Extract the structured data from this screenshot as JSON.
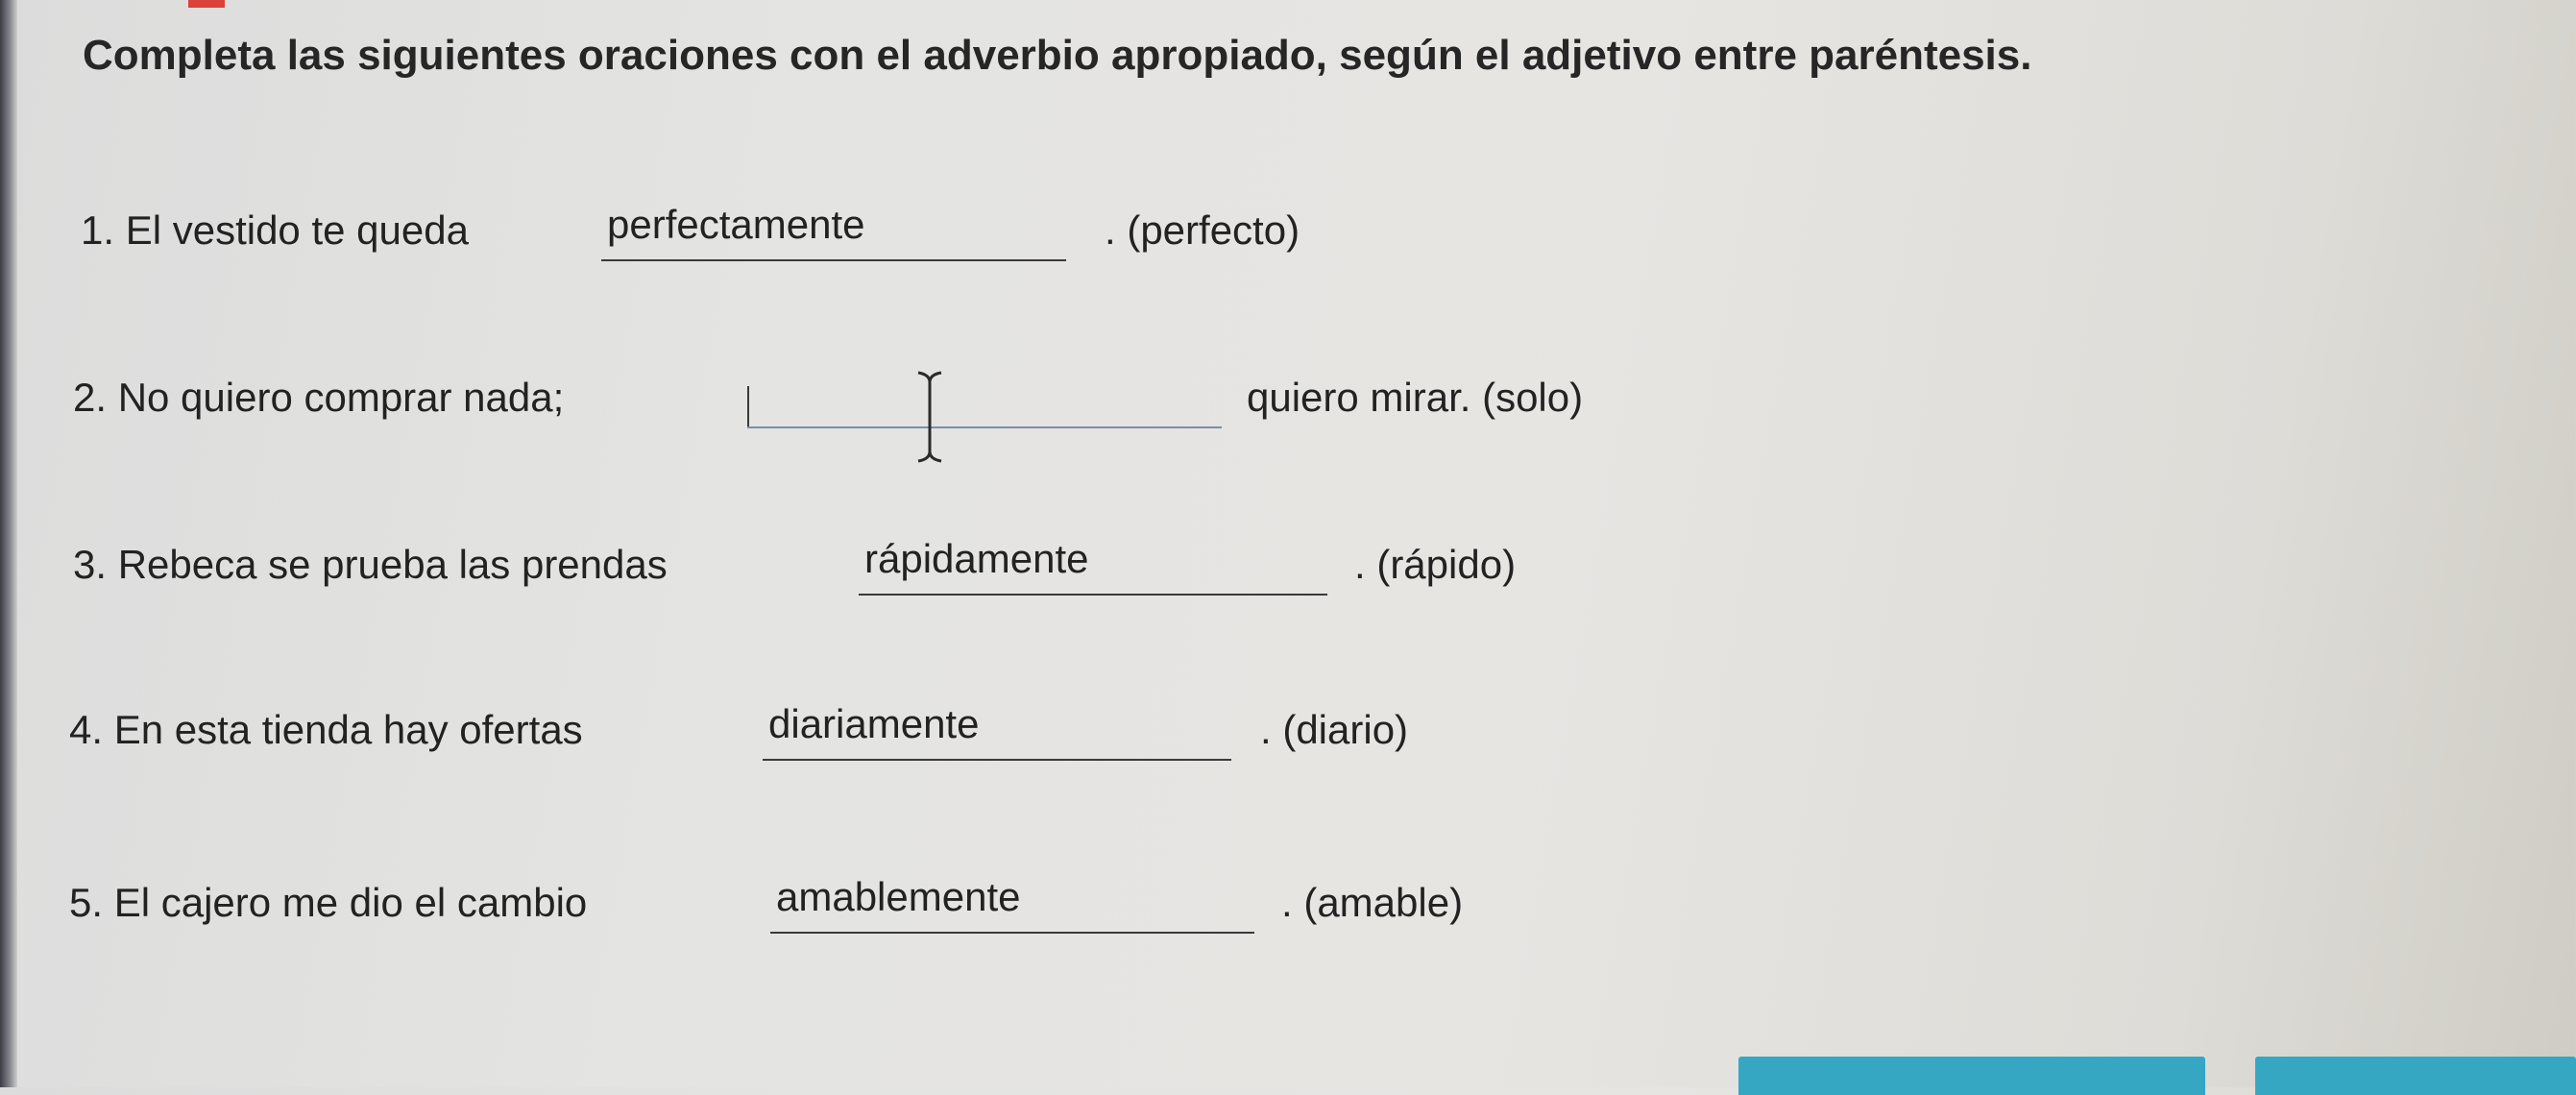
{
  "instructions": "Completa las siguientes oraciones con el adverbio apropiado, según el adjetivo entre paréntesis.",
  "items": [
    {
      "before": "1. El vestido te queda",
      "answer": "perfectamente",
      "after": ". (perfecto)"
    },
    {
      "before": "2. No quiero comprar nada;",
      "answer": "",
      "after": "quiero mirar. (solo)"
    },
    {
      "before": "3. Rebeca se prueba las prendas",
      "answer": "rápidamente",
      "after": ". (rápido)"
    },
    {
      "before": "4. En esta tienda hay ofertas",
      "answer": "diariamente",
      "after": ". (diario)"
    },
    {
      "before": "5. El cajero me dio el cambio",
      "answer": "amablemente",
      "after": ". (amable)"
    }
  ],
  "colors": {
    "button": "#36a7c3",
    "text": "#222222",
    "active_underline": "#7b8ea8"
  },
  "icons": {
    "cursor": "text-cursor-icon"
  }
}
